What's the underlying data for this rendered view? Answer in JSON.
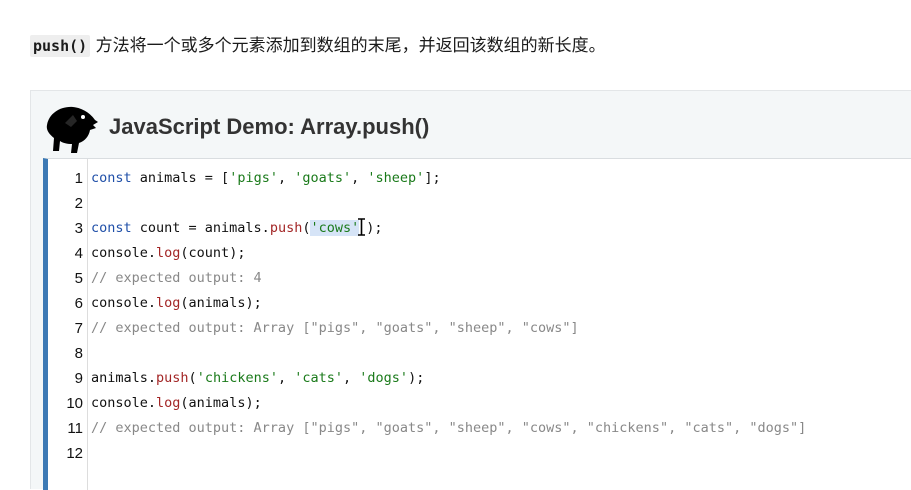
{
  "intro": {
    "method_code": "push()",
    "description": " 方法将一个或多个元素添加到数组的末尾，并返回该数组的新长度。"
  },
  "demo": {
    "title": "JavaScript Demo: Array.push()",
    "line_numbers": [
      "1",
      "2",
      "3",
      "4",
      "5",
      "6",
      "7",
      "8",
      "9",
      "10",
      "11",
      "12"
    ],
    "code": {
      "l1": {
        "kw": "const",
        "rest": " animals = [",
        "s1": "'pigs'",
        "c1": ", ",
        "s2": "'goats'",
        "c2": ", ",
        "s3": "'sheep'",
        "end": "];"
      },
      "l3": {
        "kw": "const",
        "rest": " count = animals.",
        "fn": "push",
        "open": "(",
        "str": "'cows'",
        "close": ");"
      },
      "l4": {
        "obj": "console.",
        "fn": "log",
        "args": "(count);"
      },
      "l5": {
        "comment": "// expected output: 4"
      },
      "l6": {
        "obj": "console.",
        "fn": "log",
        "args": "(animals);"
      },
      "l7": {
        "comment": "// expected output: Array [\"pigs\", \"goats\", \"sheep\", \"cows\"]"
      },
      "l9": {
        "obj": "animals.",
        "fn": "push",
        "open": "(",
        "s1": "'chickens'",
        "c1": ", ",
        "s2": "'cats'",
        "c2": ", ",
        "s3": "'dogs'",
        "close": ");"
      },
      "l10": {
        "obj": "console.",
        "fn": "log",
        "args": "(animals);"
      },
      "l11": {
        "comment": "// expected output: Array [\"pigs\", \"goats\", \"sheep\", \"cows\", \"chickens\", \"cats\", \"dogs\"]"
      }
    }
  },
  "icons": {
    "logo": "dinosaur-logo-icon",
    "cursor": "text-cursor-icon"
  },
  "colors": {
    "keyword": "#1f4fa8",
    "string": "#1a7a1a",
    "function": "#a32626",
    "comment": "#888888",
    "editor_border": "#3d7ab5"
  }
}
